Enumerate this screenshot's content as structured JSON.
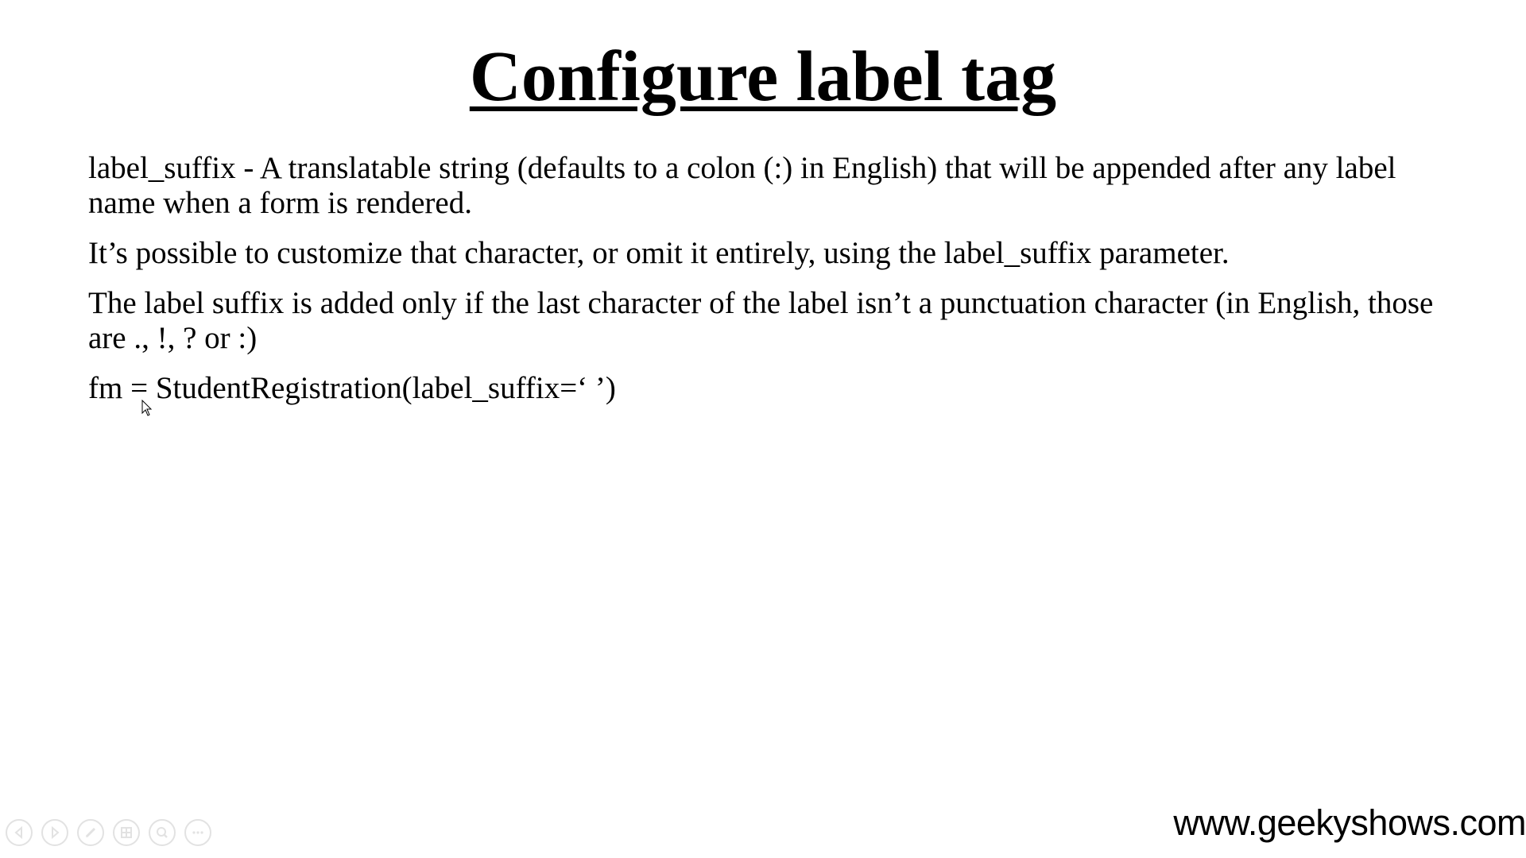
{
  "slide": {
    "title": "Configure label tag",
    "paragraphs": [
      "label_suffix - A translatable string (defaults to a colon (:) in English) that will be appended after any label name when a form is rendered.",
      "It’s possible to customize that character, or omit it entirely, using the label_suffix parameter.",
      "The label suffix is added only if the last character of the label isn’t a punctuation character (in English, those are ., !, ? or :)",
      "fm = StudentRegistration(label_suffix=‘ ’)"
    ],
    "footer_url": "www.geekyshows.com"
  },
  "controls": {
    "icons": [
      "previous-icon",
      "next-icon",
      "pen-icon",
      "slides-icon",
      "zoom-icon",
      "more-icon"
    ]
  },
  "colors": {
    "text": "#000000",
    "background": "#ffffff",
    "control_stroke": "#e2e2e2"
  }
}
